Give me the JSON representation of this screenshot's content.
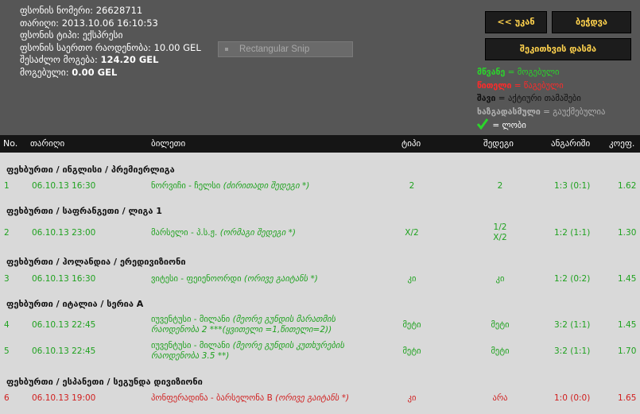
{
  "slip_info": {
    "number_label": "ფსონის ნომერი:",
    "number": "26628711",
    "date_label": "თარიღი:",
    "date": "2013.10.06 16:10:53",
    "type_label": "ფსონის ტიპი:",
    "type": "ექსპრესი",
    "total_label": "ფსონის საერთო რაოდენობა:",
    "total": "10.00 GEL",
    "possible_label": "შესაძლო მოგება:",
    "possible": "124.20 GEL",
    "won_label": "მოგებული:",
    "won": "0.00 GEL"
  },
  "snip_widget": {
    "label": "Rectangular Snip"
  },
  "buttons": {
    "back": "<< უკან",
    "close": "ბეჭდვა",
    "report": "შეკითხვის დასმა"
  },
  "legend": {
    "green_word": "მწვანე",
    "green_text": " = მოგებული",
    "red_word": "წითელი",
    "red_text": " = წაგებული",
    "black_word": "შავი",
    "black_text": " = აქტიური თამაშები",
    "gray_word": "ხაზგადასმული",
    "gray_text": " = გაუქმებულია",
    "check_text": " = ლობი"
  },
  "colors": {
    "win": "#1fa21f",
    "loss": "#d11f1f",
    "header_bg": "#565656",
    "button_text": "#ffd24d"
  },
  "table": {
    "columns": [
      "No.",
      "თარიღი",
      "ბილეთი",
      "ტიპი",
      "შედეგი",
      "ანგარიში",
      "კოეფ."
    ],
    "groups": [
      {
        "title": "ფეხბურთი / ინგლისი / პრემიერლიგა",
        "rows": [
          {
            "no": "1",
            "date": "06.10.13 16:30",
            "event": "ნორვიჩი - ჩელსი",
            "note": "(ძირითადი შედეგი *)",
            "type": "2",
            "result": "2",
            "score": "1:3 (0:1)",
            "odds": "1.62",
            "status": "win"
          }
        ]
      },
      {
        "title": "ფეხბურთი / საფრანგეთი / ლიგა 1",
        "rows": [
          {
            "no": "2",
            "date": "06.10.13 23:00",
            "event": "მარსელი - პ.ს.ჟ.",
            "note": "(ორმაგი შედეგი *)",
            "type": "X/2",
            "result": "1/2\nX/2",
            "score": "1:2 (1:1)",
            "odds": "1.30",
            "status": "win"
          }
        ]
      },
      {
        "title": "ფეხბურთი / ჰოლანდია / ერედივიზიონი",
        "rows": [
          {
            "no": "3",
            "date": "06.10.13 16:30",
            "event": "ვიტესი - ფეიენოორდი",
            "note": "(ორივე გაიტანს *)",
            "type": "კი",
            "result": "კი",
            "score": "1:2 (0:2)",
            "odds": "1.45",
            "status": "win"
          }
        ]
      },
      {
        "title": "ფეხბურთი / იტალია / სერია A",
        "rows": [
          {
            "no": "4",
            "date": "06.10.13 22:45",
            "event": "იუვენტუსი - მილანი",
            "note": "(მეორე გუნდის მარათმის რაოდენობა 2 ***(ყვითელი =1,წითელი=2))",
            "type": "მეტი",
            "result": "მეტი",
            "score": "3:2 (1:1)",
            "odds": "1.45",
            "status": "win"
          },
          {
            "no": "5",
            "date": "06.10.13 22:45",
            "event": "იუვენტუსი - მილანი",
            "note": "(მეორე გუნდის კუთხურების რაოდენობა 3.5 **)",
            "type": "მეტი",
            "result": "მეტი",
            "score": "3:2 (1:1)",
            "odds": "1.70",
            "status": "win"
          }
        ]
      },
      {
        "title": "ფეხბურთი / ესპანეთი / სეგუნდა დივიზიონი",
        "rows": [
          {
            "no": "6",
            "date": "06.10.13 19:00",
            "event": "პონფერადინა - ბარსელონა B",
            "note": "(ორივე გაიტანს *)",
            "type": "კი",
            "result": "არა",
            "score": "1:0 (0:0)",
            "odds": "1.65",
            "status": "loss"
          }
        ]
      }
    ]
  }
}
